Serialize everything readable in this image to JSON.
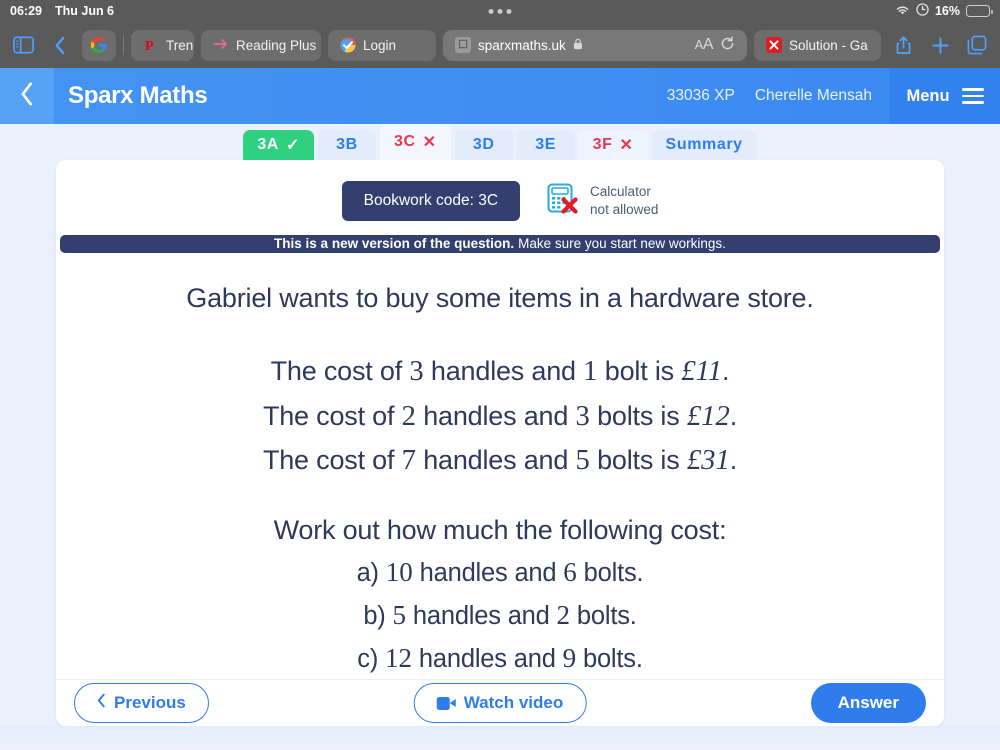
{
  "status_bar": {
    "time": "06:29",
    "date": "Thu Jun 6",
    "battery_percent": "16%",
    "battery_level": 16,
    "wifi_icon": "wifi-icon",
    "lowpower_icon": "low-power-icon"
  },
  "safari": {
    "sidebar_icon": "sidebar-icon",
    "back_icon": "back-chevron-icon",
    "google_icon": "google-icon",
    "tabs": [
      {
        "label": "Tren",
        "favicon": "pinterest-icon"
      },
      {
        "label": "Reading Plus",
        "favicon": "arrow-right-icon"
      },
      {
        "label": "Login",
        "favicon": "check-circle-icon"
      }
    ],
    "url": {
      "value": "sparxmaths.uk",
      "lock_icon": "lock-icon",
      "text_size_label": "AA",
      "reload_icon": "reload-icon",
      "blocked_icon": "blocked-icon"
    },
    "right_tab": {
      "label": "Solution - Ga",
      "favicon": "x-red-icon"
    },
    "share_icon": "share-icon",
    "new_tab_icon": "plus-icon",
    "tabs_overview_icon": "tabs-overview-icon"
  },
  "app_header": {
    "back_icon": "back-chevron-icon",
    "brand": "Sparx Maths",
    "xp": "33036 XP",
    "user": "Cherelle Mensah",
    "menu_label": "Menu",
    "menu_icon": "hamburger-icon"
  },
  "question_tabs": [
    {
      "label": "3A",
      "state": "done",
      "mark": "✓"
    },
    {
      "label": "3B",
      "state": "normal",
      "mark": ""
    },
    {
      "label": "3C",
      "state": "wrong",
      "mark": "✕",
      "active": true
    },
    {
      "label": "3D",
      "state": "normal",
      "mark": ""
    },
    {
      "label": "3E",
      "state": "normal",
      "mark": ""
    },
    {
      "label": "3F",
      "state": "wrong",
      "mark": "✕"
    },
    {
      "label": "Summary",
      "state": "normal",
      "mark": ""
    }
  ],
  "card": {
    "bookwork_code": "Bookwork code: 3C",
    "calculator_icon": "calculator-not-allowed-icon",
    "calculator_line1": "Calculator",
    "calculator_line2": "not allowed",
    "banner_bold": "This is a new version of the question.",
    "banner_rest": "Make sure you start new workings."
  },
  "question": {
    "intro": "Gabriel wants to buy some items in a hardware store.",
    "facts": [
      {
        "pre": "The cost of ",
        "n1": "3",
        "mid": " handles and ",
        "n2": "1",
        "post": " bolt is ",
        "cost": "£11",
        "end": "."
      },
      {
        "pre": "The cost of ",
        "n1": "2",
        "mid": " handles and ",
        "n2": "3",
        "post": " bolts is ",
        "cost": "£12",
        "end": "."
      },
      {
        "pre": "The cost of ",
        "n1": "7",
        "mid": " handles and ",
        "n2": "5",
        "post": " bolts is ",
        "cost": "£31",
        "end": "."
      }
    ],
    "prompt": "Work out how much the following cost:",
    "parts": [
      {
        "label": "a)",
        "n1": "10",
        "mid": " handles and ",
        "n2": "6",
        "end": " bolts."
      },
      {
        "label": "b)",
        "n1": "5",
        "mid": " handles and ",
        "n2": "2",
        "end": " bolts."
      },
      {
        "label": "c)",
        "n1": "12",
        "mid": " handles and ",
        "n2": "9",
        "end": " bolts."
      }
    ]
  },
  "footer": {
    "previous_label": "Previous",
    "previous_icon": "chevron-left-icon",
    "watch_video_label": "Watch video",
    "video_icon": "video-camera-icon",
    "answer_label": "Answer"
  },
  "colors": {
    "header_blue": "#3a89f0",
    "accent_blue": "#2f7ded",
    "navy": "#323f6f",
    "green": "#2fd07f",
    "red": "#e8384f",
    "page_bg": "#eaf1fd"
  }
}
